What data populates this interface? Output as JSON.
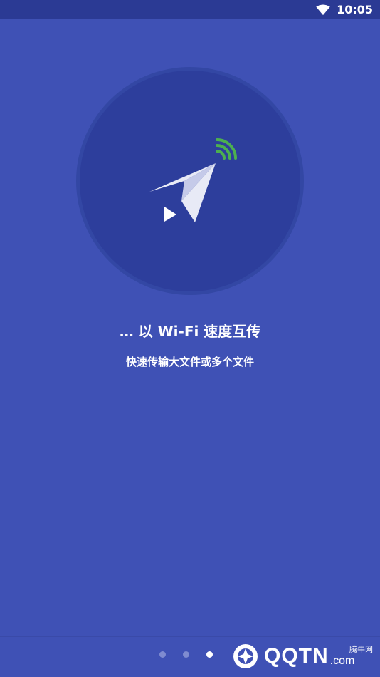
{
  "status_bar": {
    "time": "10:05",
    "wifi_icon": "wifi-icon"
  },
  "onboarding": {
    "headline": "… 以 Wi-Fi 速度互传",
    "subline": "快速传输大文件或多个文件",
    "icon": "paper-plane-wifi-icon",
    "page_indicator": {
      "total_visible": 3,
      "active_index": 2
    }
  },
  "watermark": {
    "brand": "QQTN",
    "suffix": ".com",
    "cn_name": "腾牛网"
  },
  "colors": {
    "background": "#3f51b5",
    "circle": "#2d3e9c",
    "signal_green": "#4caf50",
    "plane": "#e8eaf6"
  }
}
